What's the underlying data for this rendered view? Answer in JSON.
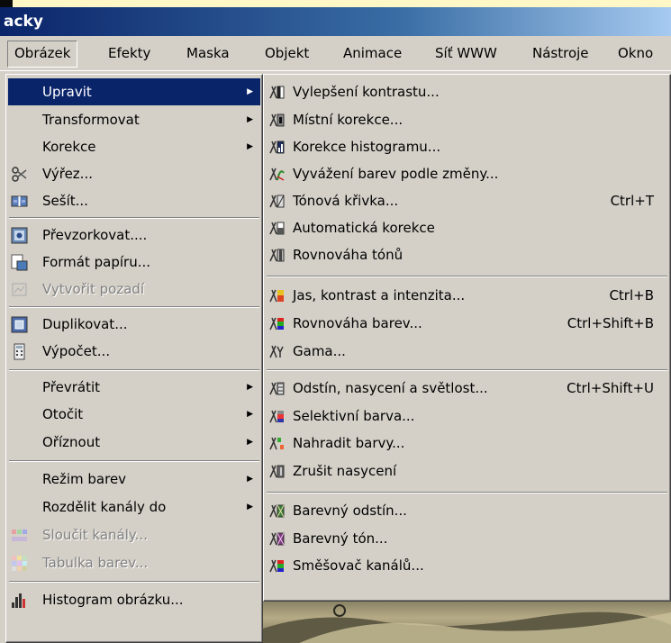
{
  "title": "acky",
  "menubar": [
    "Obrázek",
    "Efekty",
    "Maska",
    "Objekt",
    "Animace",
    "Síť WWW",
    "Nástroje",
    "Okno"
  ],
  "left_menu": [
    {
      "label": "Upravit",
      "submenu": true,
      "selected": true
    },
    {
      "label": "Transformovat",
      "submenu": true
    },
    {
      "label": "Korekce",
      "submenu": true
    },
    {
      "label": "Výřez...",
      "icon": "scissors-icon"
    },
    {
      "label": "Sešít...",
      "icon": "stitch-icon"
    },
    {
      "label": "Převzorkovat....",
      "icon": "resample-icon"
    },
    {
      "label": "Formát papíru...",
      "icon": "paper-format-icon"
    },
    {
      "label": "Vytvořit pozadí",
      "icon": "create-background-icon",
      "disabled": true
    },
    {
      "label": "Duplikovat...",
      "icon": "duplicate-icon"
    },
    {
      "label": "Výpočet...",
      "icon": "calculator-icon"
    },
    {
      "label": "Převrátit",
      "submenu": true
    },
    {
      "label": "Otočit",
      "submenu": true
    },
    {
      "label": "Oříznout",
      "submenu": true
    },
    {
      "label": "Režim barev",
      "submenu": true
    },
    {
      "label": "Rozdělit kanály do",
      "submenu": true
    },
    {
      "label": "Sloučit kanály...",
      "icon": "merge-channels-icon",
      "disabled": true
    },
    {
      "label": "Tabulka barev...",
      "icon": "color-table-icon",
      "disabled": true
    },
    {
      "label": "Histogram obrázku...",
      "icon": "histogram-icon"
    }
  ],
  "right_menu": [
    {
      "label": "Vylepšení kontrastu...",
      "shortcut": "",
      "icon": "enhance-contrast-icon"
    },
    {
      "label": "Místní korekce...",
      "shortcut": "",
      "icon": "local-correction-icon"
    },
    {
      "label": "Korekce histogramu...",
      "shortcut": "",
      "icon": "histogram-correction-icon"
    },
    {
      "label": "Vyvážení barev podle změny...",
      "shortcut": "",
      "icon": "color-balance-variation-icon"
    },
    {
      "label": "Tónová křivka...",
      "shortcut": "Ctrl+T",
      "icon": "tone-curve-icon"
    },
    {
      "label": "Automatická korekce",
      "shortcut": "",
      "icon": "auto-correction-icon"
    },
    {
      "label": "Rovnováha tónů",
      "shortcut": "",
      "icon": "tone-balance-icon"
    },
    {
      "label": "Jas, kontrast a intenzita...",
      "shortcut": "Ctrl+B",
      "icon": "brightness-contrast-icon"
    },
    {
      "label": "Rovnováha barev...",
      "shortcut": "Ctrl+Shift+B",
      "icon": "color-balance-icon"
    },
    {
      "label": "Gama...",
      "shortcut": "",
      "icon": "gamma-icon"
    },
    {
      "label": "Odstín, nasycení a světlost...",
      "shortcut": "Ctrl+Shift+U",
      "icon": "hue-saturation-icon"
    },
    {
      "label": "Selektivní barva...",
      "shortcut": "",
      "icon": "selective-color-icon"
    },
    {
      "label": "Nahradit barvy...",
      "shortcut": "",
      "icon": "replace-colors-icon"
    },
    {
      "label": "Zrušit nasycení",
      "shortcut": "",
      "icon": "desaturate-icon"
    },
    {
      "label": "Barevný odstín...",
      "shortcut": "",
      "icon": "color-hue-icon"
    },
    {
      "label": "Barevný tón...",
      "shortcut": "",
      "icon": "color-tone-icon"
    },
    {
      "label": "Směšovač kanálů...",
      "shortcut": "",
      "icon": "channel-mixer-icon"
    }
  ]
}
